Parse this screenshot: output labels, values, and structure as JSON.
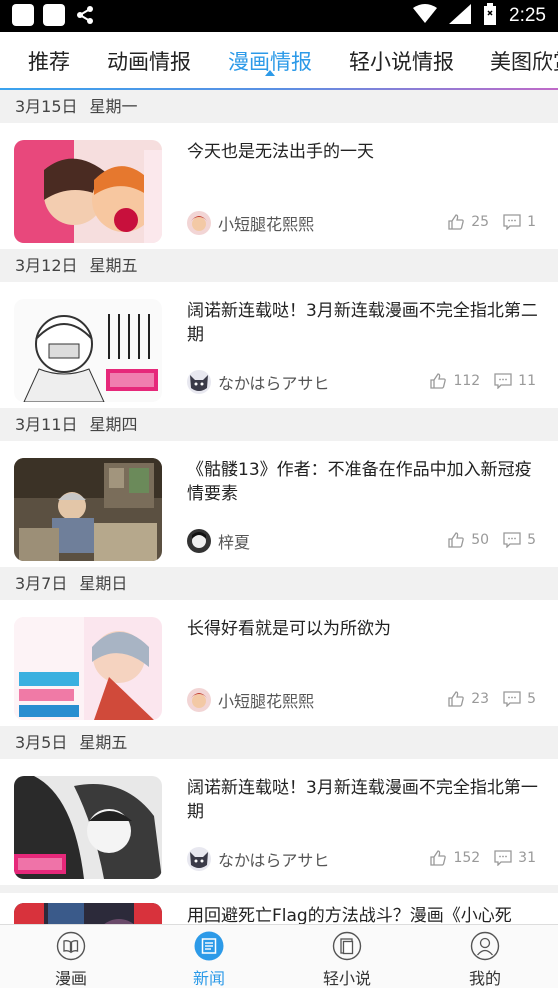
{
  "status_bar": {
    "time": "2:25"
  },
  "tabs": [
    {
      "label": "推荐"
    },
    {
      "label": "动画情报"
    },
    {
      "label": "漫画情报"
    },
    {
      "label": "轻小说情报"
    },
    {
      "label": "美图欣赏"
    }
  ],
  "active_tab": "漫画情报",
  "feed": [
    {
      "date": "3月15日",
      "weekday": "星期一",
      "title": "今天也是无法出手的一天",
      "author": "小短腿花熙熙",
      "likes": "25",
      "comments": "1"
    },
    {
      "date": "3月12日",
      "weekday": "星期五",
      "title": "阔诺新连载哒！3月新连载漫画不完全指北第二期",
      "author": "なかはらアサヒ",
      "likes": "112",
      "comments": "11"
    },
    {
      "date": "3月11日",
      "weekday": "星期四",
      "title": "《骷髅13》作者：不准备在作品中加入新冠疫情要素",
      "author": "梓夏",
      "likes": "50",
      "comments": "5"
    },
    {
      "date": "3月7日",
      "weekday": "星期日",
      "title": "长得好看就是可以为所欲为",
      "author": "小短腿花熙熙",
      "likes": "23",
      "comments": "5"
    },
    {
      "date": "3月5日",
      "weekday": "星期五",
      "title": "阔诺新连载哒！3月新连载漫画不完全指北第一期",
      "author": "なかはらアサヒ",
      "likes": "152",
      "comments": "31"
    },
    {
      "title": "用回避死亡Flag的方法战斗？漫画《小心死"
    }
  ],
  "bottom_nav": [
    {
      "label": "漫画",
      "icon": "book-icon"
    },
    {
      "label": "新闻",
      "icon": "news-icon"
    },
    {
      "label": "轻小说",
      "icon": "novel-icon"
    },
    {
      "label": "我的",
      "icon": "profile-icon"
    }
  ],
  "colors": {
    "accent": "#2c9ae8",
    "background": "#f1f1f1"
  }
}
